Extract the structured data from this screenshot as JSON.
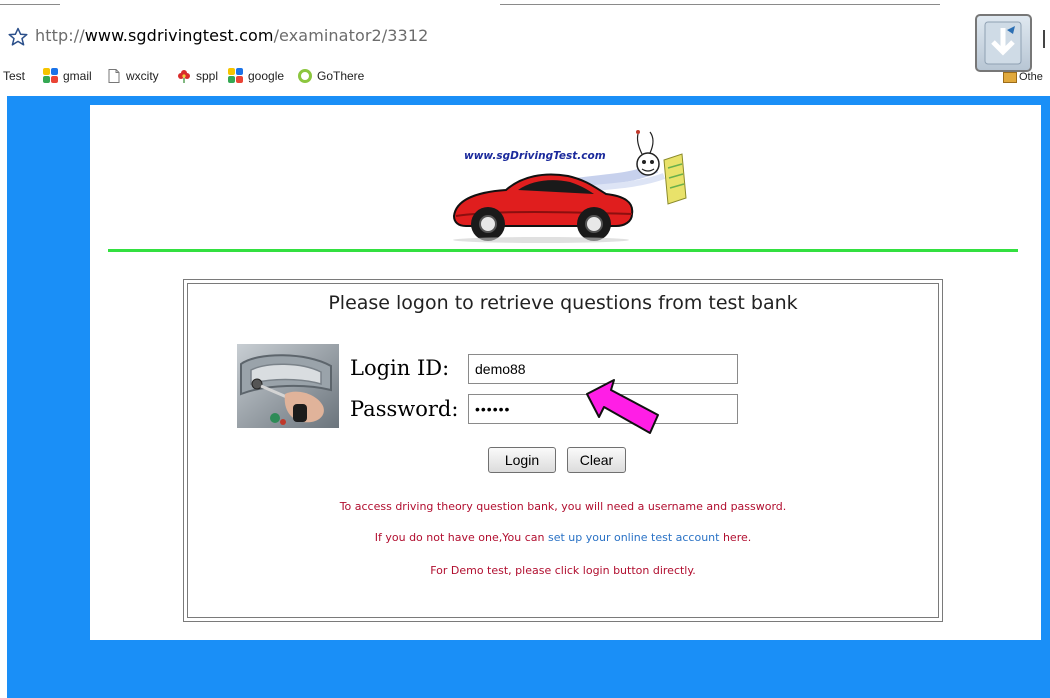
{
  "browser": {
    "url_protocol": "http://",
    "url_host": "www.sgdrivingtest.com",
    "url_path": "/examinator2/3312",
    "bookmarks": [
      {
        "label": "Test",
        "icon": "none"
      },
      {
        "label": "gmail",
        "icon": "google-icon"
      },
      {
        "label": "wxcity",
        "icon": "page-icon"
      },
      {
        "label": "sppl",
        "icon": "flower-icon"
      },
      {
        "label": "google",
        "icon": "google-icon"
      },
      {
        "label": "GoThere",
        "icon": "ring-icon"
      }
    ],
    "other_bookmarks_label": "Othe"
  },
  "header": {
    "logo_text": "www.sgDrivingTest.com"
  },
  "login": {
    "prompt": "Please logon to retrieve questions from test bank",
    "login_id_label": "Login ID:",
    "password_label": "Password:",
    "login_id_value": "demo88",
    "password_value": "••••••",
    "login_button": "Login",
    "clear_button": "Clear"
  },
  "info": {
    "line1": "To access driving theory question bank, you will need a username and password.",
    "line2_prefix": "If you do not have one,You can ",
    "line2_link": "set up your online test account",
    "line2_suffix": " here.",
    "line3": "For Demo test, please click login button directly."
  },
  "colors": {
    "page_background": "#1a8ff7",
    "divider": "#33e040",
    "info_text": "#b10e2f",
    "link": "#2a72c5",
    "annotation_arrow": "#ff1ee6"
  }
}
